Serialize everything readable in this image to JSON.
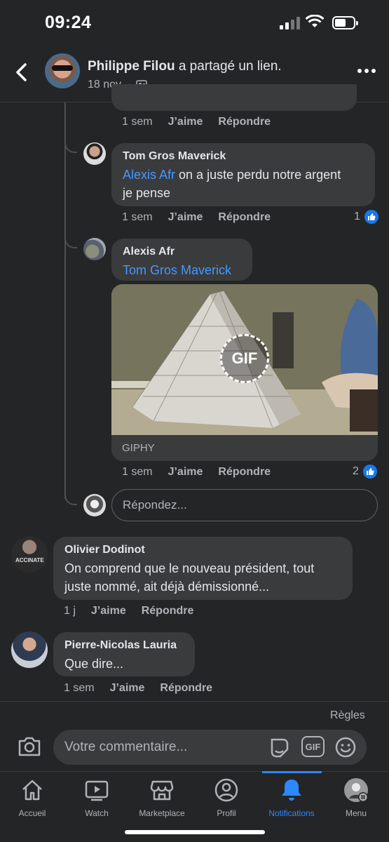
{
  "status_bar": {
    "time": "09:24"
  },
  "header": {
    "author": "Philippe Filou",
    "action": " a partagé un lien.",
    "date": "18 nov.",
    "separator": "·"
  },
  "comments": [
    {
      "id": "partial",
      "time": "1 sem",
      "like": "J’aime",
      "reply": "Répondre"
    },
    {
      "id": "tom",
      "author": "Tom Gros Maverick",
      "mention": "Alexis Afr",
      "text_line1": " on a juste perdu notre argent",
      "text_line2": "je pense",
      "time": "1 sem",
      "like": "J’aime",
      "reply": "Répondre",
      "reaction_count": "1"
    },
    {
      "id": "alexis",
      "author": "Alexis Afr",
      "mention": "Tom Gros Maverick",
      "gif_label": "GIPHY",
      "gif_badge": "GIF",
      "time": "1 sem",
      "like": "J’aime",
      "reply": "Répondre",
      "reaction_count": "2"
    },
    {
      "id": "olivier",
      "author": "Olivier Dodinot",
      "text_line1": "On comprend que le nouveau président, tout",
      "text_line2": "juste nommé, ait déjà démissionné...",
      "time": "1 j",
      "like": "J’aime",
      "reply": "Répondre",
      "avatar_text": "ACCINATE"
    },
    {
      "id": "pierre",
      "author": "Pierre-Nicolas Lauria",
      "text_line1": "Que dire...",
      "time": "1 sem",
      "like": "J’aime",
      "reply": "Répondre"
    }
  ],
  "reply_input": {
    "placeholder": "Répondez..."
  },
  "composer": {
    "rules": "Règles",
    "placeholder": "Votre commentaire...",
    "gif_button": "GIF"
  },
  "tabs": [
    {
      "label": "Accueil",
      "icon": "home-icon"
    },
    {
      "label": "Watch",
      "icon": "watch-icon"
    },
    {
      "label": "Marketplace",
      "icon": "marketplace-icon"
    },
    {
      "label": "Profil",
      "icon": "profile-icon"
    },
    {
      "label": "Notifications",
      "icon": "bell-icon",
      "active": true
    },
    {
      "label": "Menu",
      "icon": "menu-avatar-icon"
    }
  ],
  "colors": {
    "background": "#242526",
    "bubble": "#3a3b3c",
    "accent": "#2d88ff",
    "mention": "#4599ff"
  }
}
